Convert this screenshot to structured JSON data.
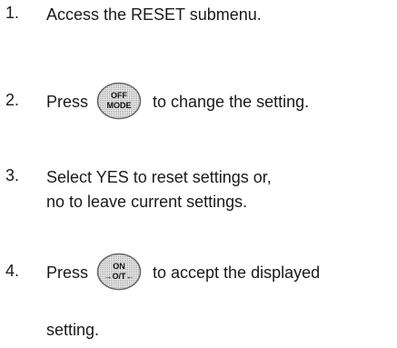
{
  "steps": [
    {
      "number": "1.",
      "text": "Access the RESET submenu."
    },
    {
      "number": "2.",
      "before": "Press",
      "after": "to change the setting."
    },
    {
      "number": "3.",
      "line1": "Select YES to reset settings or,",
      "line2": "no to leave current settings."
    },
    {
      "number": "4.",
      "before": "Press",
      "after": "to accept the displayed",
      "continuation": "setting."
    }
  ],
  "buttons": {
    "mode": {
      "top": "OFF",
      "bottom": "MODE"
    },
    "onoff": {
      "top": "ON",
      "bottom": "→O/T←"
    }
  }
}
